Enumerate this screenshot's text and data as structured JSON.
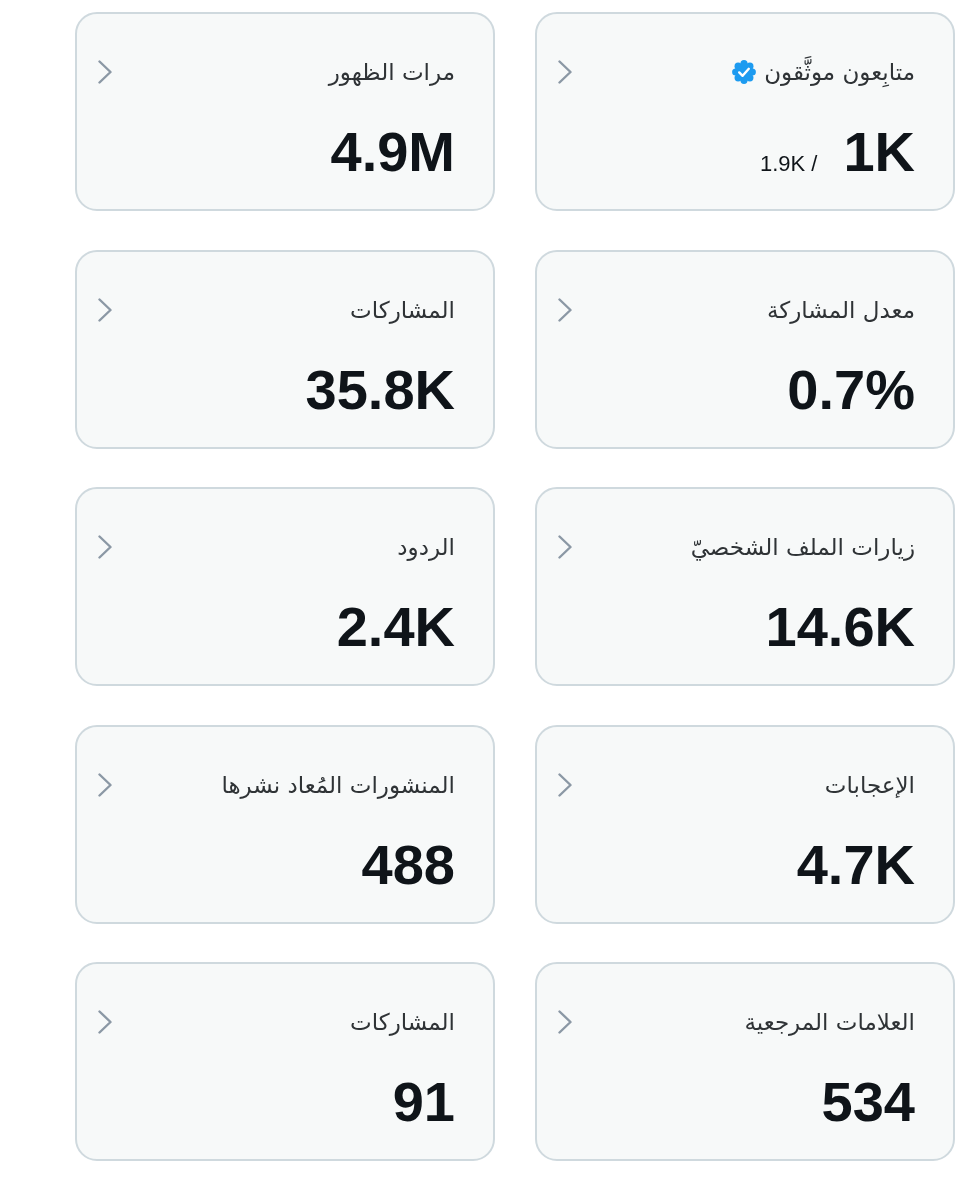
{
  "metrics": [
    {
      "label": "متابِعون موثَّقون",
      "verified": true,
      "value": "1K",
      "total": "/ 1.9K"
    },
    {
      "label": "مرات الظهور",
      "verified": false,
      "value": "4.9M"
    },
    {
      "label": "معدل المشاركة",
      "verified": false,
      "value": "0.7%"
    },
    {
      "label": "المشاركات",
      "verified": false,
      "value": "35.8K"
    },
    {
      "label": "زيارات الملف الشخصيّ",
      "verified": false,
      "value": "14.6K"
    },
    {
      "label": "الردود",
      "verified": false,
      "value": "2.4K"
    },
    {
      "label": "الإعجابات",
      "verified": false,
      "value": "4.7K"
    },
    {
      "label": "المنشورات المُعاد نشرها",
      "verified": false,
      "value": "488"
    },
    {
      "label": "العلامات المرجعية",
      "verified": false,
      "value": "534"
    },
    {
      "label": "المشاركات",
      "verified": false,
      "value": "91"
    }
  ]
}
